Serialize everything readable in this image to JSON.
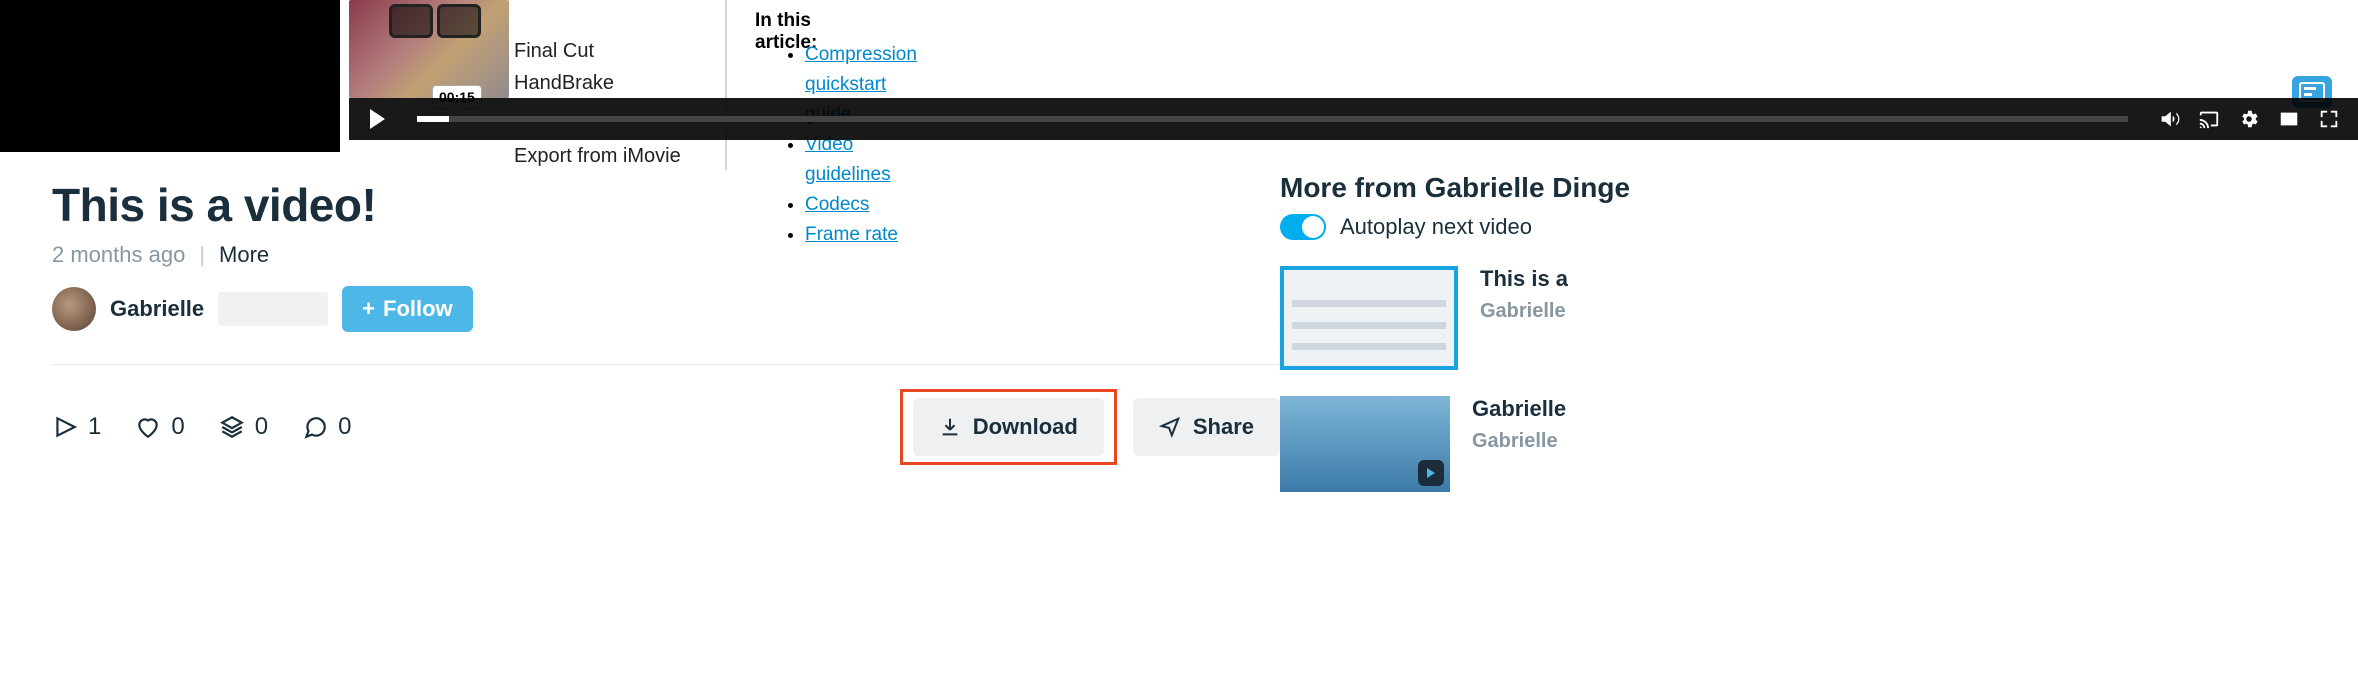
{
  "video": {
    "timestamp": "00:15",
    "slide_labels": {
      "a": "Final Cut",
      "b": "HandBrake",
      "c": "Export from iMovie"
    },
    "article": {
      "heading": "In this article:",
      "links": [
        "Compression quickstart guide",
        "Video guidelines",
        "Codecs",
        "Frame rate"
      ]
    }
  },
  "page": {
    "title": "This is a video!",
    "age": "2 months ago",
    "more_label": "More",
    "author": "Gabrielle",
    "follow_label": "Follow"
  },
  "stats": {
    "plays": "1",
    "likes": "0",
    "collections": "0",
    "comments": "0"
  },
  "actions": {
    "download": "Download",
    "share": "Share"
  },
  "sidebar": {
    "heading": "More from Gabrielle Dinge",
    "autoplay_label": "Autoplay next video",
    "items": [
      {
        "title": "This is a",
        "author": "Gabrielle"
      },
      {
        "title": "Gabrielle",
        "author": "Gabrielle"
      }
    ]
  }
}
